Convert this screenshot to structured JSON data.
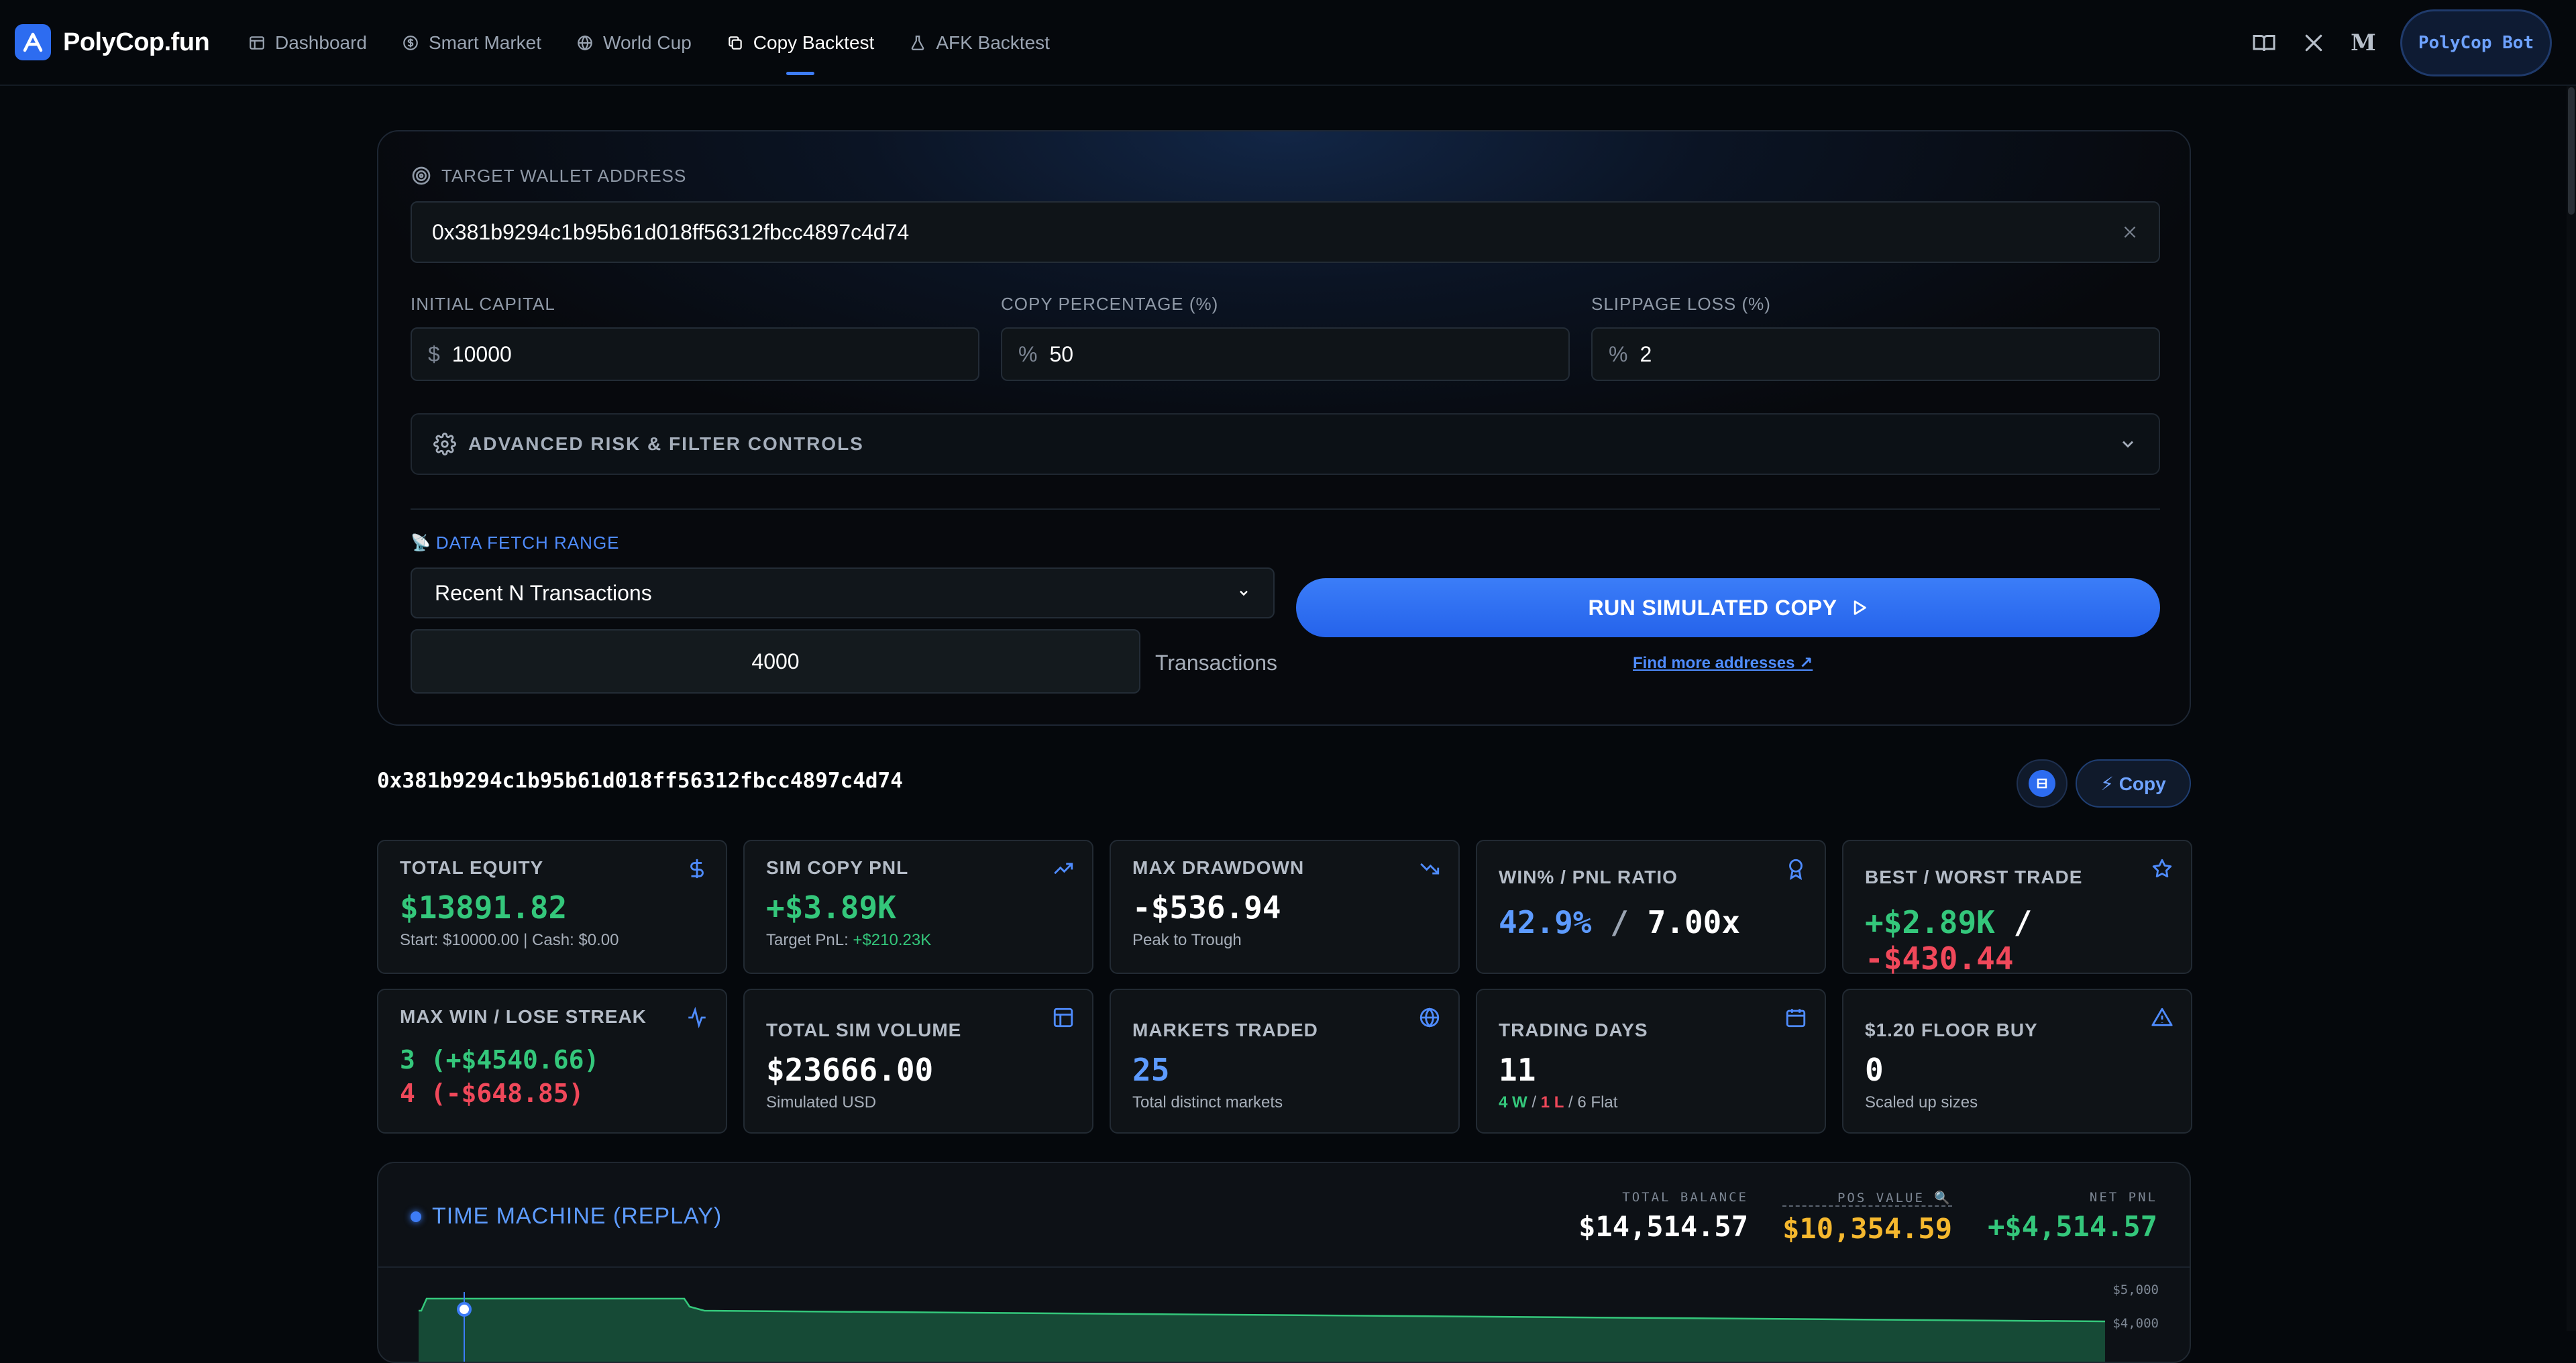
{
  "nav": {
    "brand": "PolyCop.fun",
    "links": [
      {
        "label": "Dashboard",
        "icon": "dashboard-icon"
      },
      {
        "label": "Smart Market",
        "icon": "dollar-coin-icon"
      },
      {
        "label": "World Cup",
        "icon": "globe-icon"
      },
      {
        "label": "Copy Backtest",
        "icon": "copy-icon",
        "active": true
      },
      {
        "label": "AFK Backtest",
        "icon": "flask-icon"
      }
    ],
    "right_icons": [
      "book-icon",
      "x-logo-icon",
      "medium-icon"
    ],
    "medium_glyph": "M",
    "bot_button": "PolyCop Bot"
  },
  "form": {
    "target_label": "TARGET WALLET ADDRESS",
    "target_value": "0x381b9294c1b95b61d018ff56312fbcc4897c4d74",
    "capital_label": "INITIAL CAPITAL",
    "capital_prefix": "$",
    "capital_value": "10000",
    "copy_pct_label": "COPY PERCENTAGE (%)",
    "copy_pct_prefix": "%",
    "copy_pct_value": "50",
    "slippage_label": "SLIPPAGE LOSS (%)",
    "slippage_prefix": "%",
    "slippage_value": "2",
    "advanced_label": "ADVANCED RISK & FILTER CONTROLS",
    "range_label": "DATA FETCH RANGE",
    "range_select": "Recent N Transactions",
    "tx_count": "4000",
    "tx_unit": "Transactions",
    "run_button": "RUN SIMULATED COPY",
    "find_link": "Find more addresses ↗"
  },
  "address_row": {
    "address": "0x381b9294c1b95b61d018ff56312fbcc4897c4d74",
    "copy_button": "⚡ Copy"
  },
  "stats": [
    {
      "title": "TOTAL EQUITY",
      "value": "$13891.82",
      "sub": "Start: $10000.00 | Cash: $0.00"
    },
    {
      "title": "SIM COPY PNL",
      "value": "+$3.89K",
      "sub_prefix": "Target PnL: ",
      "sub_value": "+$210.23K"
    },
    {
      "title": "MAX DRAWDOWN",
      "value": "-$536.94",
      "sub": "Peak to Trough"
    },
    {
      "title": "WIN% / PNL RATIO",
      "value_a": "42.9%",
      "sep": "/",
      "value_b": "7.00x"
    },
    {
      "title": "BEST / WORST TRADE",
      "value_a": "+$2.89K",
      "sep": "/",
      "value_b": "-$430.44"
    },
    {
      "title": "MAX WIN / LOSE STREAK",
      "line1": "3 (+$4540.66)",
      "line2": "4 (-$648.85)"
    },
    {
      "title": "TOTAL SIM VOLUME",
      "value": "$23666.00",
      "sub": "Simulated USD"
    },
    {
      "title": "MARKETS TRADED",
      "value": "25",
      "sub": "Total distinct markets"
    },
    {
      "title": "TRADING DAYS",
      "value": "11",
      "w": "4 W",
      "l": "1 L",
      "flat": "6 Flat",
      "sep": "/"
    },
    {
      "title": "$1.20 FLOOR BUY",
      "value": "0",
      "sub": "Scaled up sizes"
    }
  ],
  "time_machine": {
    "title": "TIME MACHINE (REPLAY)",
    "total_balance_label": "TOTAL BALANCE",
    "total_balance": "$14,514.57",
    "pos_value_label": "POS VALUE 🔍",
    "pos_value": "$10,354.59",
    "net_pnl_label": "NET PNL",
    "net_pnl": "+$4,514.57",
    "y_ticks": [
      "$5,000",
      "$4,000"
    ]
  },
  "colors": {
    "accent": "#3d7cf6",
    "green": "#34c77b",
    "red": "#f0485a",
    "yellow": "#f5b82e",
    "background": "#05080c"
  }
}
